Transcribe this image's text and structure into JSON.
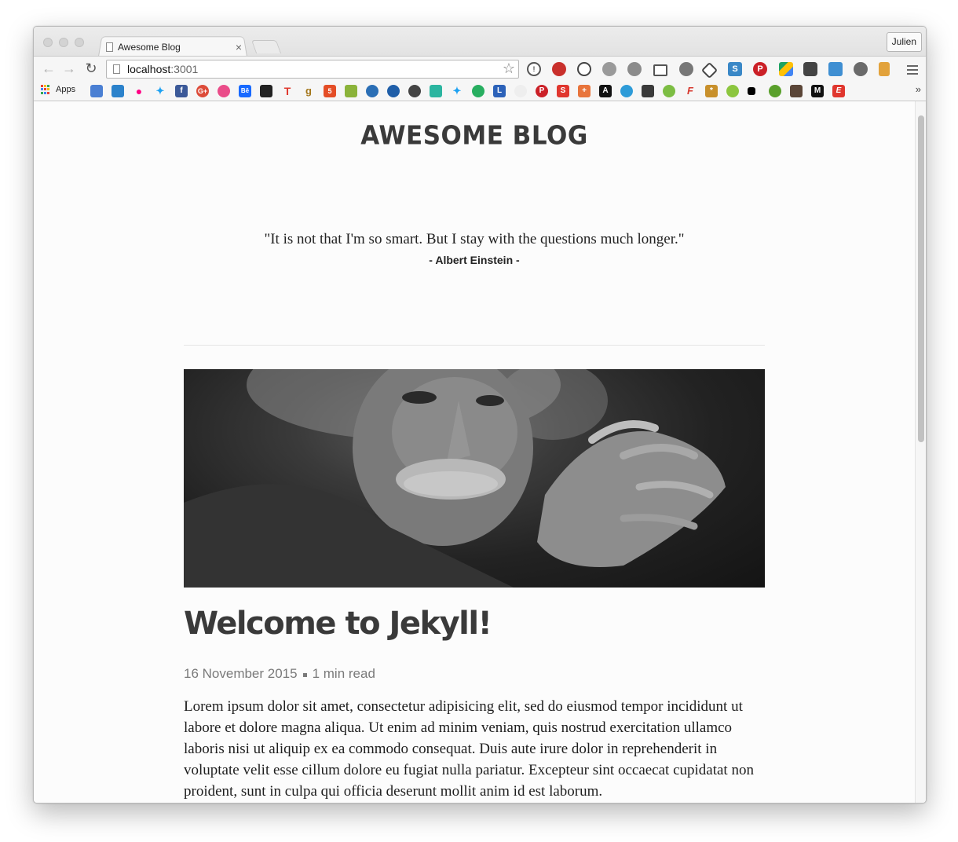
{
  "browser": {
    "tab_title": "Awesome Blog",
    "tab_close": "×",
    "profile_name": "Julien",
    "url_host": "localhost",
    "url_port": ":3001",
    "bookmarks_apps_label": "Apps",
    "bookmarks_more": "»",
    "back_glyph": "←",
    "forward_glyph": "→",
    "reload_glyph": "↻",
    "star_glyph": "☆"
  },
  "page": {
    "site_title": "AWESOME BLOG",
    "quote_text": "\"It is not that I'm so smart. But I stay with the questions much longer.\"",
    "quote_author": "- Albert Einstein -",
    "post": {
      "title": "Welcome to Jekyll!",
      "date": "16 November 2015",
      "read_time": "1 min read",
      "body": "Lorem ipsum dolor sit amet, consectetur adipisicing elit, sed do eiusmod tempor incididunt ut labore et dolore magna aliqua. Ut enim ad minim veniam, quis nostrud exercitation ullamco laboris nisi ut aliquip ex ea commodo consequat. Duis aute irure dolor in reprehenderit in voluptate velit esse cillum dolore eu fugiat nulla pariatur. Excepteur sint occaecat cupidatat non proident, sunt in culpa qui officia deserunt mollit anim id est laborum."
    }
  }
}
